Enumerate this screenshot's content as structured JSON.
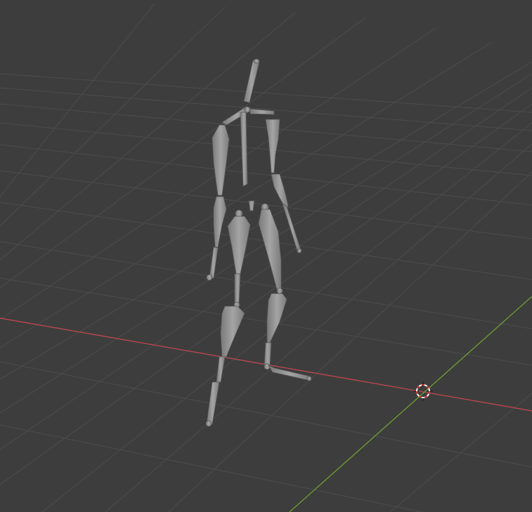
{
  "viewport": {
    "background_color": "#3d3d3d",
    "grid_color": "#4e4e4e",
    "x_axis_color": "#b7474f",
    "y_axis_color": "#6b9a32",
    "mesh_color": "#8c8c8c",
    "cursor_icon": "3d-cursor-icon",
    "object": "armature-figure"
  }
}
